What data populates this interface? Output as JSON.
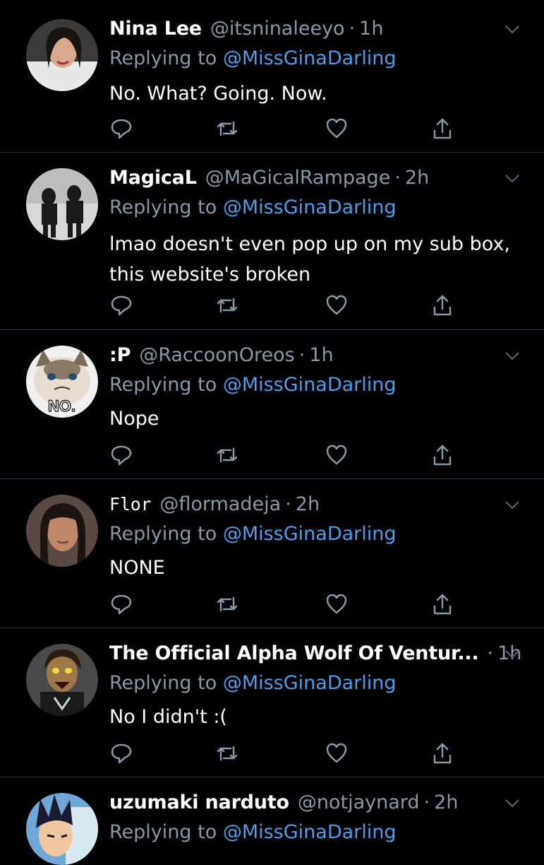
{
  "colors": {
    "background": "#000000",
    "text": "#ffffff",
    "muted": "#8899a6",
    "link": "#4d9ee8",
    "divider": "#2f3336"
  },
  "replying_prefix": "Replying to",
  "action_icons": [
    "reply-icon",
    "retweet-icon",
    "like-icon",
    "share-icon"
  ],
  "tweets": [
    {
      "display_name": "Nina Lee",
      "handle": "@itsninaleeyo",
      "separator": "·",
      "time": "1h",
      "replying_to": "@MissGinaDarling",
      "text": "No. What? Going. Now."
    },
    {
      "display_name": "MagicaL",
      "handle": "@MaGicalRampage",
      "separator": "·",
      "time": "2h",
      "replying_to": "@MissGinaDarling",
      "text": "lmao doesn't even pop up on my sub box, this website's broken"
    },
    {
      "display_name": ":P",
      "handle": "@RaccoonOreos",
      "separator": "·",
      "time": "1h",
      "replying_to": "@MissGinaDarling",
      "text": "Nope",
      "avatar_text": "NO."
    },
    {
      "display_name": "Flor",
      "handle": "@flormadeja",
      "separator": "·",
      "time": "2h",
      "replying_to": "@MissGinaDarling",
      "text": "NONE"
    },
    {
      "display_name": "The Official Alpha Wolf Of Ventur...",
      "handle": "",
      "separator": "·",
      "time": "1h",
      "replying_to": "@MissGinaDarling",
      "text": "No I didn't :("
    },
    {
      "display_name": "uzumaki narduto",
      "handle": "@notjaynard",
      "separator": "·",
      "time": "2h",
      "replying_to": "@MissGinaDarling",
      "text": ""
    }
  ]
}
